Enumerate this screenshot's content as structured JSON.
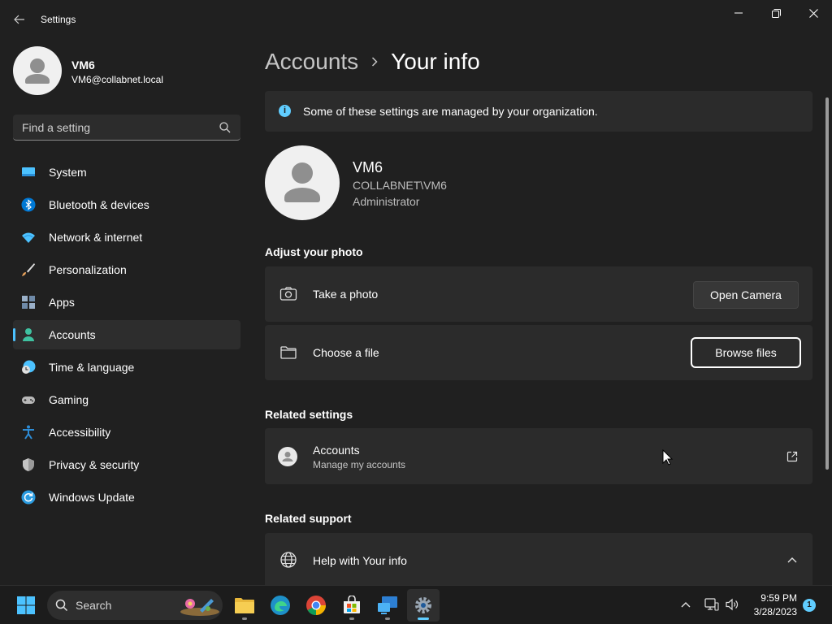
{
  "window": {
    "title": "Settings",
    "controls": [
      "minimize",
      "maximize",
      "close"
    ]
  },
  "profile": {
    "name": "VM6",
    "email": "VM6@collabnet.local"
  },
  "search": {
    "placeholder": "Find a setting"
  },
  "sidebar": {
    "items": [
      {
        "label": "System",
        "icon": "system-icon",
        "color": "#4cc2ff"
      },
      {
        "label": "Bluetooth & devices",
        "icon": "bluetooth-icon",
        "color": "#0078d4"
      },
      {
        "label": "Network & internet",
        "icon": "wifi-icon",
        "color": "#4cc2ff"
      },
      {
        "label": "Personalization",
        "icon": "brush-icon",
        "color": "#e8a25c"
      },
      {
        "label": "Apps",
        "icon": "apps-icon",
        "color": "#9ab0c8"
      },
      {
        "label": "Accounts",
        "icon": "accounts-icon",
        "color": "#3fc1a0",
        "active": true
      },
      {
        "label": "Time & language",
        "icon": "clock-globe-icon",
        "color": "#4cc2ff"
      },
      {
        "label": "Gaming",
        "icon": "gamepad-icon",
        "color": "#b9b9b9"
      },
      {
        "label": "Accessibility",
        "icon": "accessibility-icon",
        "color": "#2d8cd6"
      },
      {
        "label": "Privacy & security",
        "icon": "shield-icon",
        "color": "#9a9a9a"
      },
      {
        "label": "Windows Update",
        "icon": "update-icon",
        "color": "#2a9be0"
      }
    ]
  },
  "breadcrumb": {
    "parent": "Accounts",
    "current": "Your info"
  },
  "info_bar": {
    "text": "Some of these settings are managed by your organization."
  },
  "user": {
    "name": "VM6",
    "domain": "COLLABNET\\VM6",
    "role": "Administrator"
  },
  "adjust_photo": {
    "title": "Adjust your photo",
    "take_photo": {
      "label": "Take a photo",
      "button": "Open Camera"
    },
    "choose_file": {
      "label": "Choose a file",
      "button": "Browse files"
    }
  },
  "related_settings": {
    "title": "Related settings",
    "accounts": {
      "label": "Accounts",
      "sublabel": "Manage my accounts"
    }
  },
  "related_support": {
    "title": "Related support",
    "help": {
      "label": "Help with Your info"
    }
  },
  "taskbar": {
    "search_label": "Search",
    "apps": [
      "file-explorer-icon",
      "edge-icon",
      "chrome-icon",
      "store-icon",
      "remote-desktop-icon",
      "settings-icon"
    ],
    "time": "9:59 PM",
    "date": "3/28/2023",
    "notification_count": "1"
  },
  "colors": {
    "background": "#202020",
    "card": "#2b2b2b",
    "accent": "#4cc2ff",
    "taskbar": "#1c1c1c"
  }
}
